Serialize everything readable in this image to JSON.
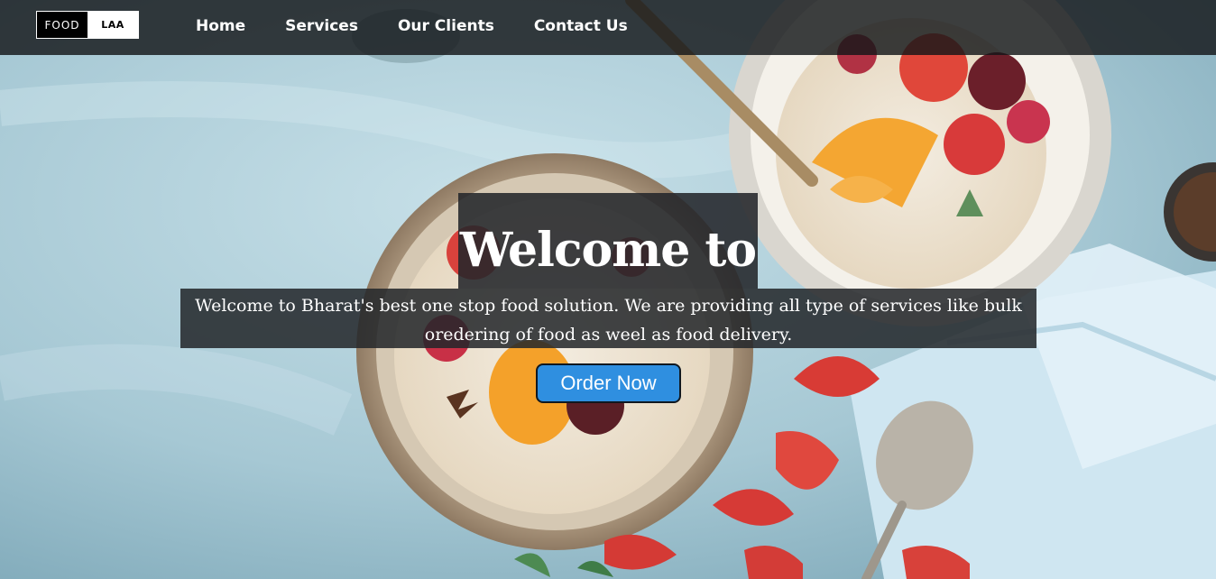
{
  "brand": {
    "part1": "FOOD",
    "part2": "LAA"
  },
  "nav": {
    "items": [
      {
        "label": "Home"
      },
      {
        "label": "Services"
      },
      {
        "label": "Our Clients"
      },
      {
        "label": "Contact Us"
      }
    ]
  },
  "hero": {
    "headline": "Welcome to",
    "tagline": "Welcome to Bharat's best one stop food solution. We are providing all type of services like bulk oredering of food as weel as food delivery.",
    "cta_label": "Order Now",
    "background_image": "food-bowls-photo"
  },
  "colors": {
    "navbar_bg": "#141618",
    "cta_bg": "#2f8fe0",
    "overlay_bg": "#23262a",
    "text": "#ffffff"
  }
}
